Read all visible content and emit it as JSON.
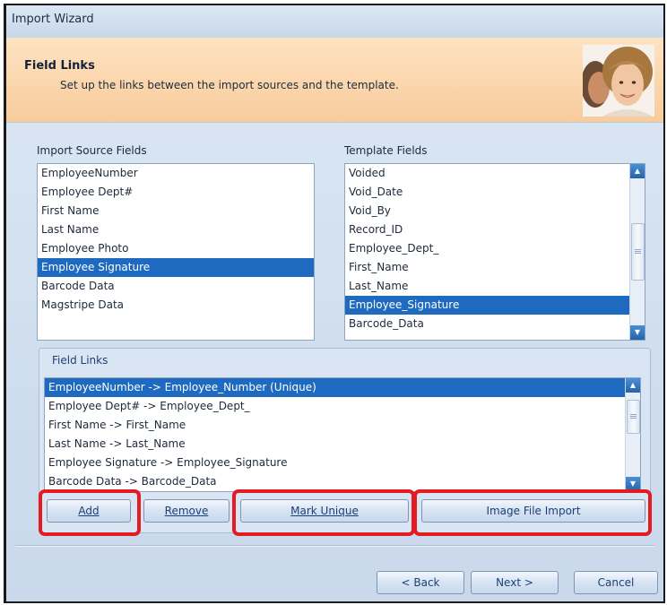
{
  "window": {
    "title": "Import Wizard"
  },
  "header": {
    "title": "Field Links",
    "subtitle": "Set up the links between the import sources and the template."
  },
  "source": {
    "label": "Import Source Fields",
    "items": [
      "EmployeeNumber",
      "Employee Dept#",
      "First Name",
      "Last Name",
      "Employee Photo",
      "Employee Signature",
      "Barcode Data",
      "Magstripe Data"
    ],
    "selected": "Employee Signature"
  },
  "template": {
    "label": "Template Fields",
    "items": [
      "Voided",
      "Void_Date",
      "Void_By",
      "Record_ID",
      "Employee_Dept_",
      "First_Name",
      "Last_Name",
      "Employee_Signature",
      "Barcode_Data"
    ],
    "selected": "Employee_Signature"
  },
  "links": {
    "label": "Field Links",
    "items": [
      "EmployeeNumber -> Employee_Number (Unique)",
      "Employee Dept# -> Employee_Dept_",
      "First Name -> First_Name",
      "Last Name -> Last_Name",
      "Employee Signature -> Employee_Signature",
      "Barcode Data -> Barcode_Data"
    ],
    "selected": "EmployeeNumber -> Employee_Number (Unique)"
  },
  "buttons": {
    "add": "Add",
    "remove": "Remove",
    "mark_unique": "Mark Unique",
    "image_file_import": "Image File Import",
    "back": "< Back",
    "next": "Next >",
    "cancel": "Cancel"
  },
  "icons": {
    "header_image": "people-avatar-icon",
    "scroll_up": "scroll-up-arrow-icon",
    "scroll_down": "scroll-down-arrow-icon"
  },
  "colors": {
    "selection": "#1e6ac0",
    "highlight": "#e31b23",
    "header_band": "#fbd6ac"
  }
}
